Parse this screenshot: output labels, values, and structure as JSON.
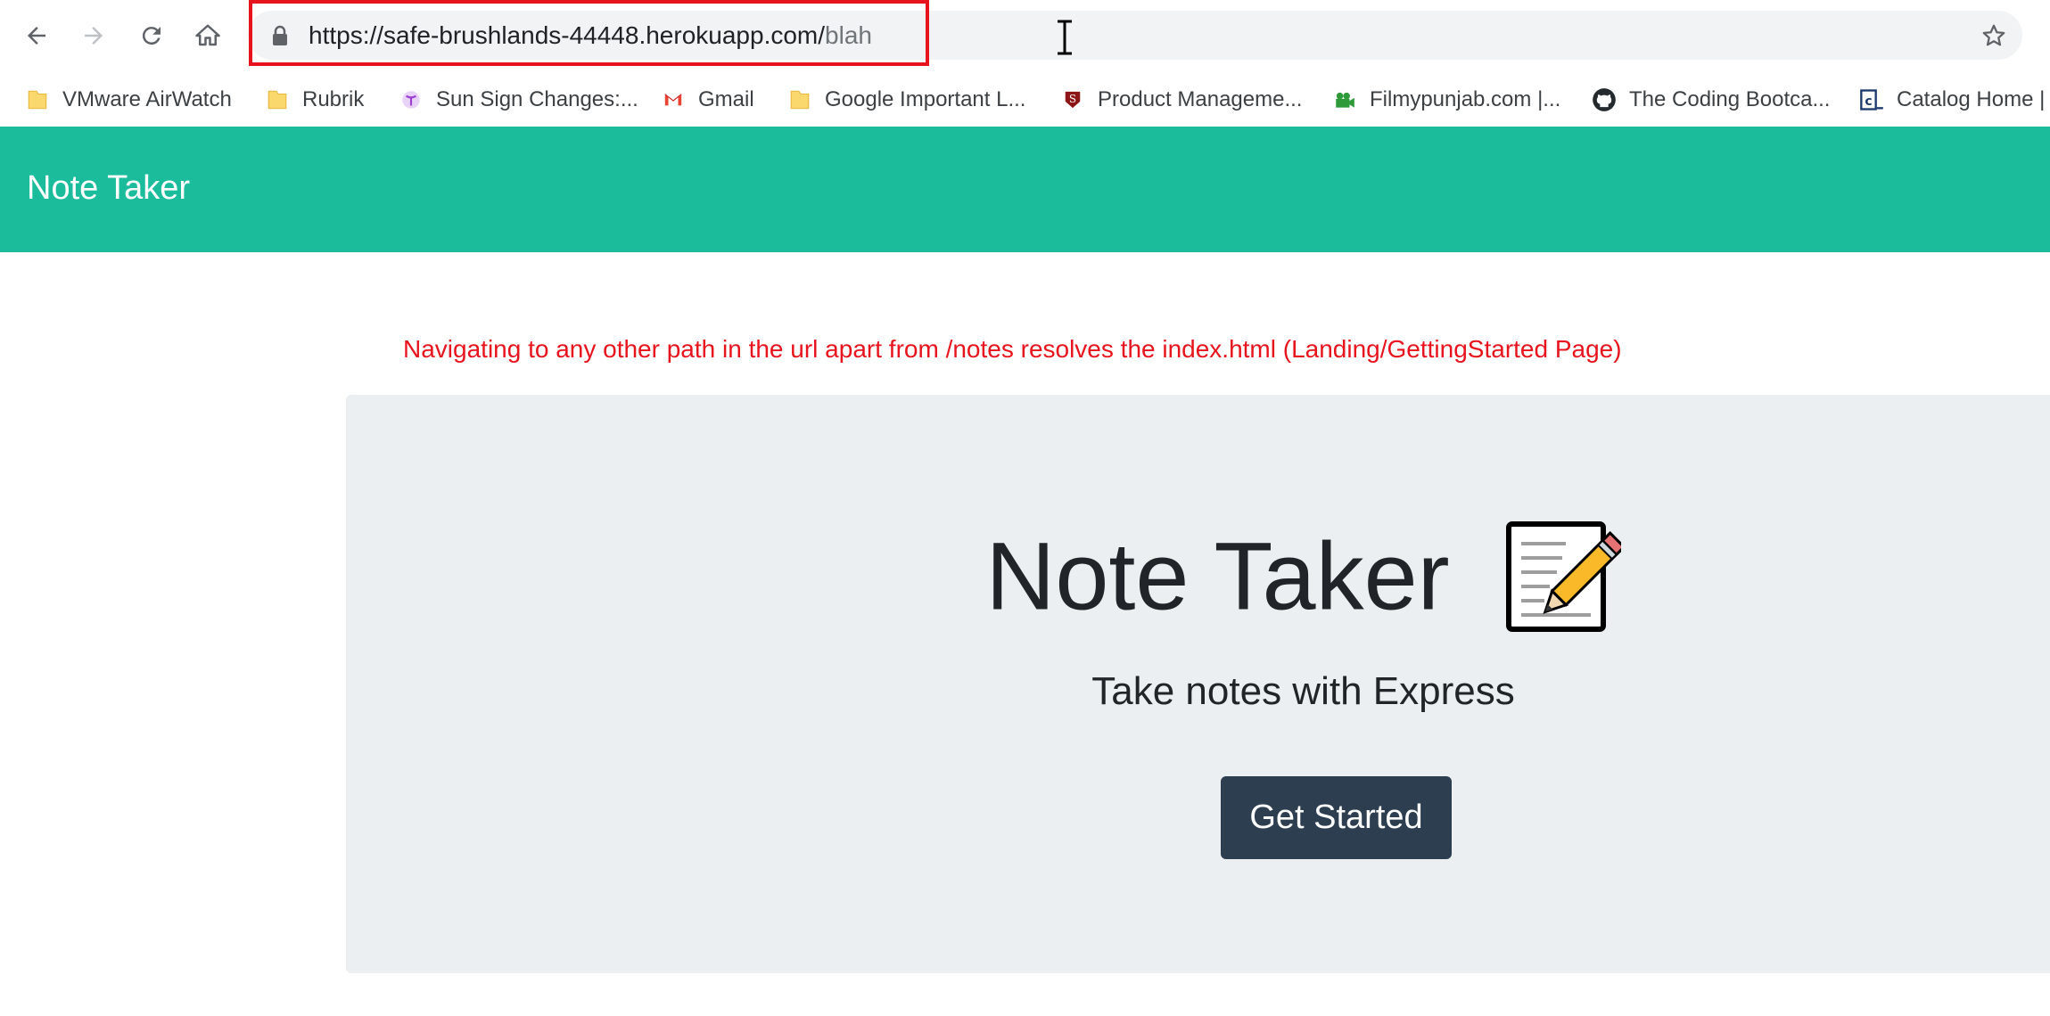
{
  "browser": {
    "url_host": "https://safe-brushlands-44448.herokuapp.com/",
    "url_path": "blah",
    "bookmarks": [
      {
        "label": "VMware AirWatch",
        "icon": "folder-icon"
      },
      {
        "label": "Rubrik",
        "icon": "folder-icon"
      },
      {
        "label": "Sun Sign Changes:...",
        "icon": "zodiac-icon"
      },
      {
        "label": "Gmail",
        "icon": "gmail-icon"
      },
      {
        "label": "Google Important L...",
        "icon": "folder-icon"
      },
      {
        "label": "Product Manageme...",
        "icon": "stanford-icon"
      },
      {
        "label": "Filmypunjab.com |...",
        "icon": "camera-icon"
      },
      {
        "label": "The Coding Bootca...",
        "icon": "github-icon"
      },
      {
        "label": "Catalog Home |",
        "icon": "catalog-icon"
      }
    ]
  },
  "app": {
    "brand": "Note Taker",
    "annotation": "Navigating to any other path in the url apart from /notes resolves the index.html (Landing/GettingStarted Page)",
    "hero_title": "Note Taker",
    "hero_subtitle": "Take notes with Express",
    "cta_label": "Get Started"
  },
  "colors": {
    "navbar": "#1abc9c",
    "jumbotron": "#eceff1",
    "button": "#2c3e50",
    "annotation": "#e8141d"
  }
}
